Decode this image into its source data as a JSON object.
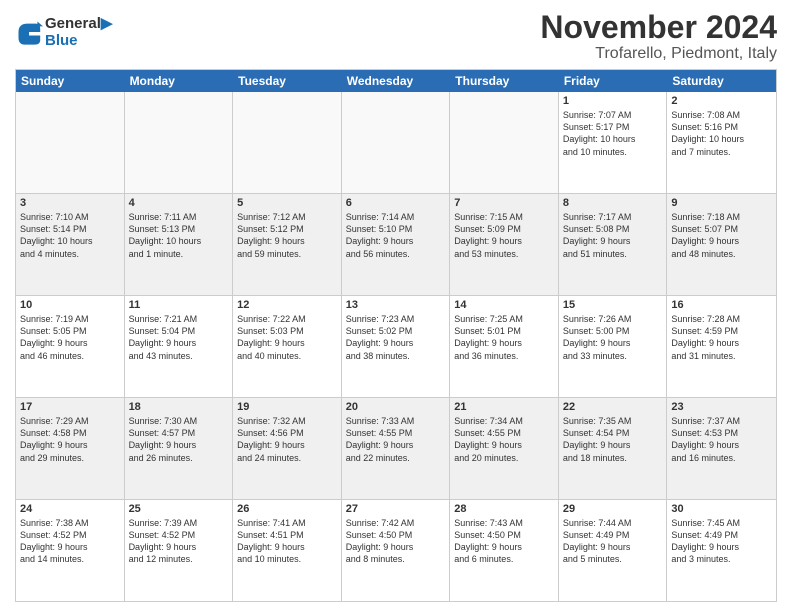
{
  "header": {
    "logo_line1": "General",
    "logo_line2": "Blue",
    "month": "November 2024",
    "location": "Trofarello, Piedmont, Italy"
  },
  "day_headers": [
    "Sunday",
    "Monday",
    "Tuesday",
    "Wednesday",
    "Thursday",
    "Friday",
    "Saturday"
  ],
  "weeks": [
    [
      {
        "day": "",
        "info": "",
        "empty": true
      },
      {
        "day": "",
        "info": "",
        "empty": true
      },
      {
        "day": "",
        "info": "",
        "empty": true
      },
      {
        "day": "",
        "info": "",
        "empty": true
      },
      {
        "day": "",
        "info": "",
        "empty": true
      },
      {
        "day": "1",
        "info": "Sunrise: 7:07 AM\nSunset: 5:17 PM\nDaylight: 10 hours\nand 10 minutes."
      },
      {
        "day": "2",
        "info": "Sunrise: 7:08 AM\nSunset: 5:16 PM\nDaylight: 10 hours\nand 7 minutes."
      }
    ],
    [
      {
        "day": "3",
        "info": "Sunrise: 7:10 AM\nSunset: 5:14 PM\nDaylight: 10 hours\nand 4 minutes."
      },
      {
        "day": "4",
        "info": "Sunrise: 7:11 AM\nSunset: 5:13 PM\nDaylight: 10 hours\nand 1 minute."
      },
      {
        "day": "5",
        "info": "Sunrise: 7:12 AM\nSunset: 5:12 PM\nDaylight: 9 hours\nand 59 minutes."
      },
      {
        "day": "6",
        "info": "Sunrise: 7:14 AM\nSunset: 5:10 PM\nDaylight: 9 hours\nand 56 minutes."
      },
      {
        "day": "7",
        "info": "Sunrise: 7:15 AM\nSunset: 5:09 PM\nDaylight: 9 hours\nand 53 minutes."
      },
      {
        "day": "8",
        "info": "Sunrise: 7:17 AM\nSunset: 5:08 PM\nDaylight: 9 hours\nand 51 minutes."
      },
      {
        "day": "9",
        "info": "Sunrise: 7:18 AM\nSunset: 5:07 PM\nDaylight: 9 hours\nand 48 minutes."
      }
    ],
    [
      {
        "day": "10",
        "info": "Sunrise: 7:19 AM\nSunset: 5:05 PM\nDaylight: 9 hours\nand 46 minutes."
      },
      {
        "day": "11",
        "info": "Sunrise: 7:21 AM\nSunset: 5:04 PM\nDaylight: 9 hours\nand 43 minutes."
      },
      {
        "day": "12",
        "info": "Sunrise: 7:22 AM\nSunset: 5:03 PM\nDaylight: 9 hours\nand 40 minutes."
      },
      {
        "day": "13",
        "info": "Sunrise: 7:23 AM\nSunset: 5:02 PM\nDaylight: 9 hours\nand 38 minutes."
      },
      {
        "day": "14",
        "info": "Sunrise: 7:25 AM\nSunset: 5:01 PM\nDaylight: 9 hours\nand 36 minutes."
      },
      {
        "day": "15",
        "info": "Sunrise: 7:26 AM\nSunset: 5:00 PM\nDaylight: 9 hours\nand 33 minutes."
      },
      {
        "day": "16",
        "info": "Sunrise: 7:28 AM\nSunset: 4:59 PM\nDaylight: 9 hours\nand 31 minutes."
      }
    ],
    [
      {
        "day": "17",
        "info": "Sunrise: 7:29 AM\nSunset: 4:58 PM\nDaylight: 9 hours\nand 29 minutes."
      },
      {
        "day": "18",
        "info": "Sunrise: 7:30 AM\nSunset: 4:57 PM\nDaylight: 9 hours\nand 26 minutes."
      },
      {
        "day": "19",
        "info": "Sunrise: 7:32 AM\nSunset: 4:56 PM\nDaylight: 9 hours\nand 24 minutes."
      },
      {
        "day": "20",
        "info": "Sunrise: 7:33 AM\nSunset: 4:55 PM\nDaylight: 9 hours\nand 22 minutes."
      },
      {
        "day": "21",
        "info": "Sunrise: 7:34 AM\nSunset: 4:55 PM\nDaylight: 9 hours\nand 20 minutes."
      },
      {
        "day": "22",
        "info": "Sunrise: 7:35 AM\nSunset: 4:54 PM\nDaylight: 9 hours\nand 18 minutes."
      },
      {
        "day": "23",
        "info": "Sunrise: 7:37 AM\nSunset: 4:53 PM\nDaylight: 9 hours\nand 16 minutes."
      }
    ],
    [
      {
        "day": "24",
        "info": "Sunrise: 7:38 AM\nSunset: 4:52 PM\nDaylight: 9 hours\nand 14 minutes."
      },
      {
        "day": "25",
        "info": "Sunrise: 7:39 AM\nSunset: 4:52 PM\nDaylight: 9 hours\nand 12 minutes."
      },
      {
        "day": "26",
        "info": "Sunrise: 7:41 AM\nSunset: 4:51 PM\nDaylight: 9 hours\nand 10 minutes."
      },
      {
        "day": "27",
        "info": "Sunrise: 7:42 AM\nSunset: 4:50 PM\nDaylight: 9 hours\nand 8 minutes."
      },
      {
        "day": "28",
        "info": "Sunrise: 7:43 AM\nSunset: 4:50 PM\nDaylight: 9 hours\nand 6 minutes."
      },
      {
        "day": "29",
        "info": "Sunrise: 7:44 AM\nSunset: 4:49 PM\nDaylight: 9 hours\nand 5 minutes."
      },
      {
        "day": "30",
        "info": "Sunrise: 7:45 AM\nSunset: 4:49 PM\nDaylight: 9 hours\nand 3 minutes."
      }
    ]
  ]
}
